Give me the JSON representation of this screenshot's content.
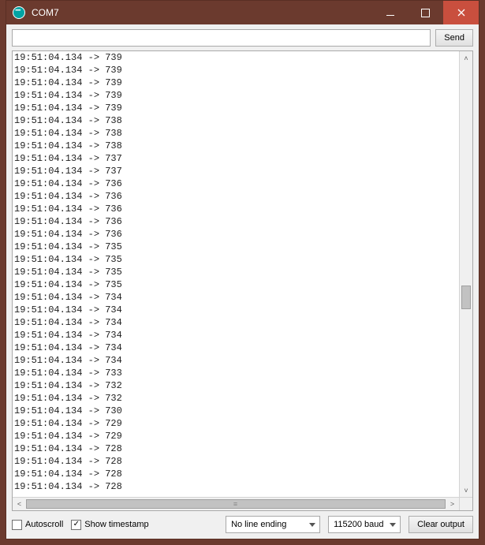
{
  "window": {
    "title": "COM7"
  },
  "toolbar": {
    "send_label": "Send",
    "input_value": ""
  },
  "log_lines": [
    "19:51:04.134 -> 739",
    "19:51:04.134 -> 739",
    "19:51:04.134 -> 739",
    "19:51:04.134 -> 739",
    "19:51:04.134 -> 739",
    "19:51:04.134 -> 738",
    "19:51:04.134 -> 738",
    "19:51:04.134 -> 738",
    "19:51:04.134 -> 737",
    "19:51:04.134 -> 737",
    "19:51:04.134 -> 736",
    "19:51:04.134 -> 736",
    "19:51:04.134 -> 736",
    "19:51:04.134 -> 736",
    "19:51:04.134 -> 736",
    "19:51:04.134 -> 735",
    "19:51:04.134 -> 735",
    "19:51:04.134 -> 735",
    "19:51:04.134 -> 735",
    "19:51:04.134 -> 734",
    "19:51:04.134 -> 734",
    "19:51:04.134 -> 734",
    "19:51:04.134 -> 734",
    "19:51:04.134 -> 734",
    "19:51:04.134 -> 734",
    "19:51:04.134 -> 733",
    "19:51:04.134 -> 732",
    "19:51:04.134 -> 732",
    "19:51:04.134 -> 730",
    "19:51:04.134 -> 729",
    "19:51:04.134 -> 729",
    "19:51:04.134 -> 728",
    "19:51:04.134 -> 728",
    "19:51:04.134 -> 728",
    "19:51:04.134 -> 728"
  ],
  "footer": {
    "autoscroll_label": "Autoscroll",
    "autoscroll_checked": false,
    "timestamp_label": "Show timestamp",
    "timestamp_checked": true,
    "line_ending": "No line ending",
    "baud": "115200 baud",
    "clear_label": "Clear output"
  }
}
